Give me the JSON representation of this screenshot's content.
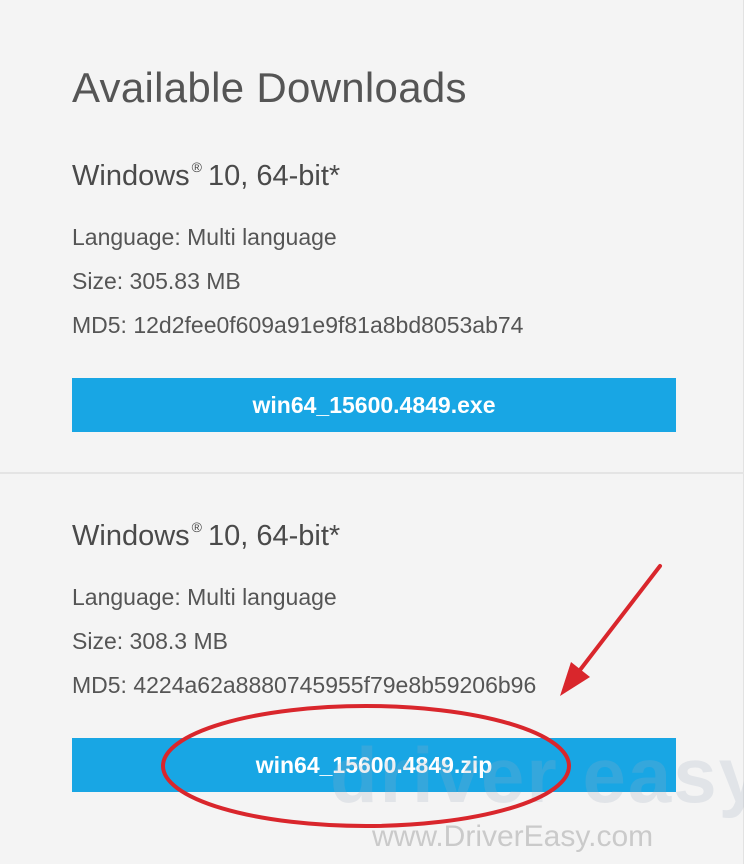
{
  "heading": "Available Downloads",
  "downloads": [
    {
      "os_name": "Windows",
      "os_mark": "®",
      "os_version": "10, 64-bit*",
      "language_label": "Language: Multi language",
      "size_label": "Size: 305.83 MB",
      "md5_label": "MD5: 12d2fee0f609a91e9f81a8bd8053ab74",
      "button_label": "win64_15600.4849.exe"
    },
    {
      "os_name": "Windows",
      "os_mark": "®",
      "os_version": "10, 64-bit*",
      "language_label": "Language: Multi language",
      "size_label": "Size: 308.3 MB",
      "md5_label": "MD5: 4224a62a8880745955f79e8b59206b96",
      "button_label": "win64_15600.4849.zip"
    }
  ],
  "watermark": {
    "logo_text": "driver easy",
    "site_text": "www.DriverEasy.com"
  },
  "colors": {
    "button": "#18a6e4",
    "annotation": "#d9262c"
  },
  "icons": [
    "annotation-arrow-icon",
    "annotation-circle-icon"
  ]
}
